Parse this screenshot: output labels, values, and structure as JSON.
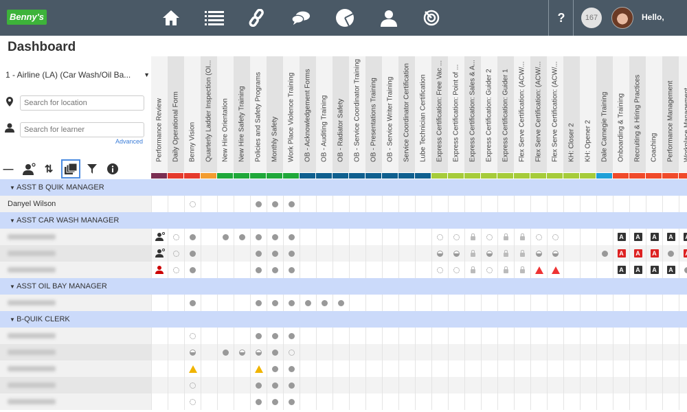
{
  "nav": {
    "logo": "Benny's",
    "icons": [
      "home-icon",
      "list-icon",
      "link-icon",
      "chat-icon",
      "pie-chart-icon",
      "user-icon",
      "target-icon"
    ],
    "help": "?",
    "notifications": "167",
    "greeting": "Hello,"
  },
  "page": {
    "title": "Dashboard"
  },
  "filters": {
    "store": "1 - Airline (LA) (Car Wash/Oil Ba...",
    "location_placeholder": "Search for location",
    "learner_placeholder": "Search for learner",
    "advanced": "Advanced"
  },
  "columns": [
    {
      "label": "Performance Review",
      "color": "#7a2e52"
    },
    {
      "label": "Daily Operational Form",
      "color": "#e53a2c"
    },
    {
      "label": "Benny Vision",
      "color": "#e53a2c"
    },
    {
      "label": "Quarterly Ladder Inspection (OI...",
      "color": "#f39c2f"
    },
    {
      "label": "New Hire Orientation",
      "color": "#1fa83a"
    },
    {
      "label": "New Hire Safety Training",
      "color": "#1fa83a"
    },
    {
      "label": "Policies and Safety Programs",
      "color": "#1fa83a"
    },
    {
      "label": "Monthly Safety",
      "color": "#1fa83a"
    },
    {
      "label": "Work Place Violence Training",
      "color": "#1fa83a"
    },
    {
      "label": "OB - Acknowledgement Forms",
      "color": "#0f5f8f"
    },
    {
      "label": "OB - Auditing Training",
      "color": "#0f5f8f"
    },
    {
      "label": "OB - Radiator Safety",
      "color": "#0f5f8f"
    },
    {
      "label": "OB - Service Coordinator Training",
      "color": "#0f5f8f"
    },
    {
      "label": "OB - Presentations Training",
      "color": "#0f5f8f"
    },
    {
      "label": "OB - Service Writer Training",
      "color": "#0f5f8f"
    },
    {
      "label": "Service Coordinator Certification",
      "color": "#0f5f8f"
    },
    {
      "label": "Lube Technician Certification",
      "color": "#0f5f8f"
    },
    {
      "label": "Express Certification: Free Vac ...",
      "color": "#a6cc3a"
    },
    {
      "label": "Express Certification: Point of ...",
      "color": "#a6cc3a"
    },
    {
      "label": "Express Certification: Sales & A...",
      "color": "#a6cc3a"
    },
    {
      "label": "Express Certification: Guider 2",
      "color": "#a6cc3a"
    },
    {
      "label": "Express Certification: Guider 1",
      "color": "#a6cc3a"
    },
    {
      "label": "Flex Serve Certification: (ACW/...",
      "color": "#a6cc3a"
    },
    {
      "label": "Flex Serve Certification: (ACW/...",
      "color": "#a6cc3a"
    },
    {
      "label": "Flex Serve Certification: (ACW/...",
      "color": "#a6cc3a"
    },
    {
      "label": "KH: Closer 2",
      "color": "#a6cc3a"
    },
    {
      "label": "KH: Opener 2",
      "color": "#a6cc3a"
    },
    {
      "label": "Dale Carnegie Training",
      "color": "#1ea0d8"
    },
    {
      "label": "Onboarding & Training",
      "color": "#f04a2a"
    },
    {
      "label": "Recruiting & Hiring Practices",
      "color": "#f04a2a"
    },
    {
      "label": "Coaching",
      "color": "#f04a2a"
    },
    {
      "label": "Performance Management",
      "color": "#f04a2a"
    },
    {
      "label": "Workplace Management",
      "color": "#f04a2a"
    }
  ],
  "groups": [
    {
      "title": "ASST B QUIK MANAGER",
      "rows": [
        {
          "name": "Danyel Wilson",
          "cells": {
            "2": "open",
            "6": "filled",
            "7": "filled",
            "8": "filled"
          }
        }
      ]
    },
    {
      "title": "ASST CAR WASH MANAGER",
      "rows": [
        {
          "name": "",
          "cells": {
            "0": "person-dark",
            "1": "open",
            "2": "filled",
            "4": "filled",
            "5": "filled",
            "6": "filled",
            "7": "filled",
            "8": "filled",
            "17": "open",
            "18": "open",
            "19": "lock",
            "20": "open",
            "21": "lock",
            "22": "lock",
            "23": "open",
            "24": "open",
            "28": "a-dark",
            "29": "a-dark",
            "30": "a-dark",
            "31": "a-dark",
            "32": "a-dark"
          }
        },
        {
          "name": "",
          "cells": {
            "0": "person-dark",
            "1": "open",
            "2": "filled",
            "6": "filled",
            "7": "filled",
            "8": "filled",
            "17": "half",
            "18": "half",
            "19": "lock",
            "20": "half",
            "21": "lock",
            "22": "lock",
            "23": "half",
            "24": "half",
            "27": "filled",
            "28": "a-red",
            "29": "a-red",
            "30": "a-red",
            "31": "filled",
            "32": "a-red"
          }
        },
        {
          "name": "",
          "cells": {
            "0": "person-red",
            "1": "open",
            "2": "filled",
            "6": "filled",
            "7": "filled",
            "8": "filled",
            "17": "open",
            "18": "open",
            "19": "lock",
            "20": "open",
            "21": "lock",
            "22": "lock",
            "23": "warn-red",
            "24": "warn-red",
            "28": "a-dark",
            "29": "a-dark",
            "30": "a-dark",
            "31": "a-dark",
            "32": "filled"
          }
        }
      ]
    },
    {
      "title": "ASST OIL BAY MANAGER",
      "rows": [
        {
          "name": "",
          "cells": {
            "2": "filled",
            "6": "filled",
            "7": "filled",
            "8": "filled",
            "9": "filled",
            "10": "filled",
            "11": "filled"
          }
        }
      ]
    },
    {
      "title": "B-QUIK CLERK",
      "rows": [
        {
          "name": "",
          "cells": {
            "2": "open",
            "6": "filled",
            "7": "filled",
            "8": "filled"
          }
        },
        {
          "name": "",
          "cells": {
            "2": "half",
            "4": "filled",
            "5": "half",
            "6": "half",
            "7": "filled",
            "8": "open"
          }
        },
        {
          "name": "",
          "cells": {
            "2": "warn-yellow",
            "6": "warn-yellow",
            "7": "filled",
            "8": "filled"
          }
        },
        {
          "name": "",
          "cells": {
            "2": "open",
            "6": "filled",
            "7": "filled",
            "8": "filled"
          }
        },
        {
          "name": "",
          "cells": {
            "2": "open",
            "6": "filled",
            "7": "filled",
            "8": "filled"
          }
        }
      ]
    }
  ]
}
